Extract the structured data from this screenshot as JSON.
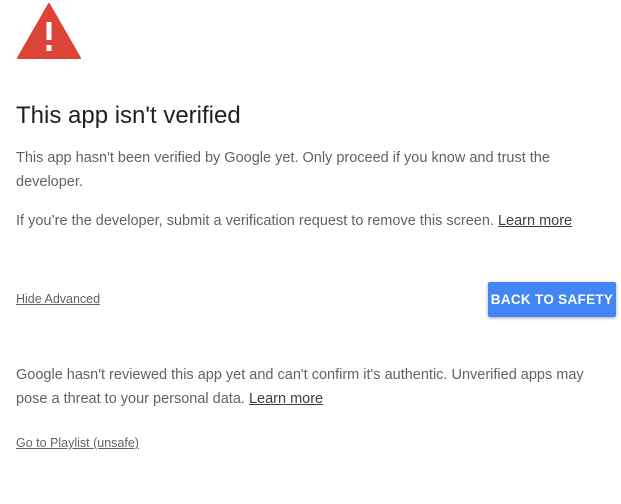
{
  "colors": {
    "warning_red": "#DB4437",
    "primary_button": "#4285F4",
    "body_text": "#5F6368",
    "title_text": "#202124"
  },
  "header": {
    "icon": "warning-triangle-icon",
    "title": "This app isn't verified"
  },
  "body": {
    "paragraph_1": "This app hasn't been verified by Google yet. Only proceed if you know and trust the developer.",
    "paragraph_2_text": "If you’re the developer, submit a verification request to remove this screen.",
    "paragraph_2_link": "Learn more"
  },
  "actions": {
    "hide_advanced_label": "Hide Advanced",
    "back_to_safety_label": "BACK TO SAFETY"
  },
  "advanced": {
    "paragraph_text": "Google hasn't reviewed this app yet and can't confirm it's authentic. Unverified apps may pose a threat to your personal data.",
    "paragraph_link": "Learn more",
    "unsafe_link_label": "Go to Playlist (unsafe)"
  }
}
